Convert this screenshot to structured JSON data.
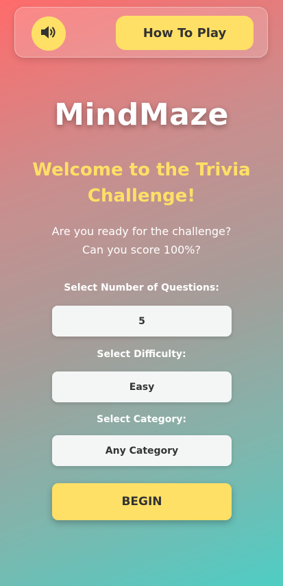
{
  "header": {
    "sound_icon": "speaker-volume-icon",
    "how_to_play_label": "How To Play"
  },
  "app": {
    "title": "MindMaze"
  },
  "welcome": {
    "heading": "Welcome to the Trivia Challenge!",
    "line1": "Are you ready for the challenge?",
    "line2": "Can you score 100%?"
  },
  "form": {
    "questions_label": "Select Number of Questions:",
    "questions_value": "5",
    "difficulty_label": "Select Difficulty:",
    "difficulty_value": "Easy",
    "category_label": "Select Category:",
    "category_value": "Any Category",
    "begin_label": "BEGIN"
  },
  "colors": {
    "accent": "#ffe066",
    "gradient_start": "#ff6b6b",
    "gradient_end": "#4ecdc4"
  }
}
